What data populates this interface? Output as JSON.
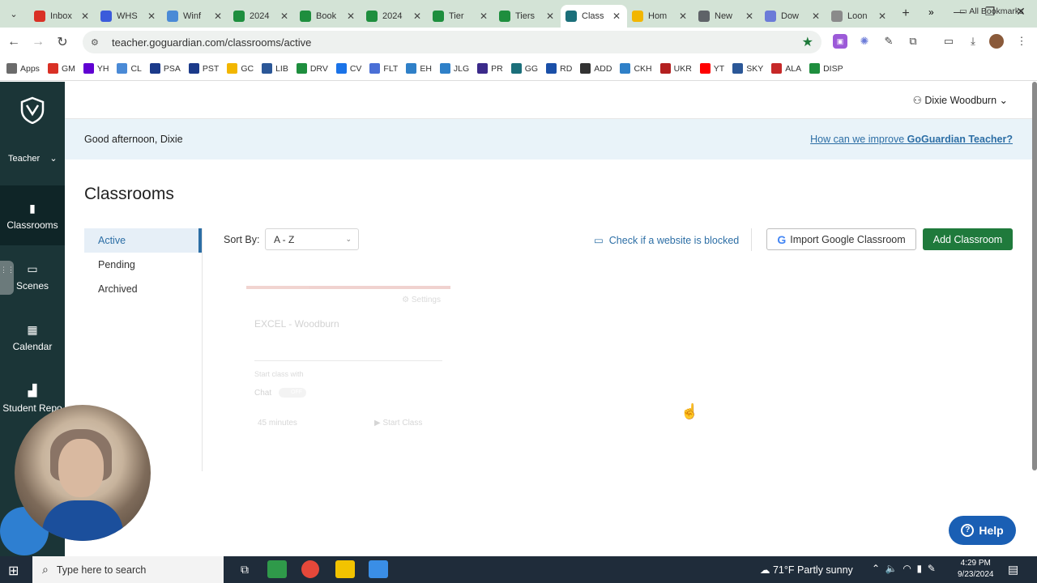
{
  "browser": {
    "tabs": [
      {
        "title": "Inbox",
        "color": "#d93025",
        "icon": "gmail-icon"
      },
      {
        "title": "WHS",
        "color": "#3b5bdb",
        "icon": "forms-icon"
      },
      {
        "title": "Winf",
        "color": "#4a8ad6",
        "icon": "calendar-icon"
      },
      {
        "title": "2024",
        "color": "#1e8e3e",
        "icon": "sheets-icon"
      },
      {
        "title": "Book",
        "color": "#1e8e3e",
        "icon": "sheets-icon"
      },
      {
        "title": "2024",
        "color": "#1e8e3e",
        "icon": "sheets-icon"
      },
      {
        "title": "Tier",
        "color": "#1e8e3e",
        "icon": "sheets-icon"
      },
      {
        "title": "Tiers",
        "color": "#1e8e3e",
        "icon": "sheets-icon"
      },
      {
        "title": "Class",
        "color": "#1b6f7a",
        "icon": "goguardian-icon",
        "active": true
      },
      {
        "title": "Hom",
        "color": "#f2b600",
        "icon": "classroom-icon"
      },
      {
        "title": "New",
        "color": "#5f6368",
        "icon": "chrome-icon"
      },
      {
        "title": "Dow",
        "color": "#6b7bd8",
        "icon": "gear-icon"
      },
      {
        "title": "Loon",
        "color": "#8a8a8a",
        "icon": "web-icon"
      }
    ],
    "new_tab": "+",
    "url": "teacher.goguardian.com/classrooms/active",
    "bookmarks": [
      {
        "label": "Apps",
        "color": "#6b6b6b"
      },
      {
        "label": "GM",
        "color": "#d93025"
      },
      {
        "label": "YH",
        "color": "#6001d2"
      },
      {
        "label": "CL",
        "color": "#4a8ad6"
      },
      {
        "label": "PSA",
        "color": "#1b3a8a"
      },
      {
        "label": "PST",
        "color": "#1b3a8a"
      },
      {
        "label": "GC",
        "color": "#f2b600"
      },
      {
        "label": "LIB",
        "color": "#2b5797"
      },
      {
        "label": "DRV",
        "color": "#1e8e3e"
      },
      {
        "label": "CV",
        "color": "#1a73e8"
      },
      {
        "label": "FLT",
        "color": "#4a6fd6"
      },
      {
        "label": "EH",
        "color": "#2f80c8"
      },
      {
        "label": "JLG",
        "color": "#2f80c8"
      },
      {
        "label": "PR",
        "color": "#3b2a8a"
      },
      {
        "label": "GG",
        "color": "#1b6f7a"
      },
      {
        "label": "RD",
        "color": "#1a4fa8"
      },
      {
        "label": "ADD",
        "color": "#333333"
      },
      {
        "label": "CKH",
        "color": "#2f80c8"
      },
      {
        "label": "UKR",
        "color": "#b32020"
      },
      {
        "label": "YT",
        "color": "#ff0000"
      },
      {
        "label": "SKY",
        "color": "#2b5797"
      },
      {
        "label": "ALA",
        "color": "#c62828"
      },
      {
        "label": "DISP",
        "color": "#1e8e3e"
      }
    ],
    "bookmarks_more": "»",
    "all_bookmarks": "All Bookmarks"
  },
  "sidebar": {
    "role": "Teacher",
    "items": [
      {
        "label": "Classrooms",
        "icon": "book-icon",
        "active": true
      },
      {
        "label": "Scenes",
        "icon": "scenes-icon"
      },
      {
        "label": "Calendar",
        "icon": "calendar-icon"
      },
      {
        "label": "Student Repo",
        "icon": "bar-chart-icon"
      }
    ]
  },
  "header": {
    "user": "Dixie Woodburn",
    "greeting": "Good afternoon, Dixie",
    "improve_prefix": "How can we improve ",
    "improve_brand": "GoGuardian Teacher?"
  },
  "main": {
    "title": "Classrooms",
    "subnav": [
      "Active",
      "Pending",
      "Archived"
    ],
    "sort_label": "Sort By:",
    "sort_value": "A - Z",
    "check_link": "Check if a website is blocked",
    "import_button": "Import Google Classroom",
    "add_button": "Add Classroom",
    "card": {
      "settings": "Settings",
      "name": "EXCEL - Woodburn",
      "start_with": "Start class with",
      "chat": "Chat",
      "chat_toggle": "OFF",
      "duration": "45 minutes",
      "start": "Start Class"
    },
    "help": "Help"
  },
  "taskbar": {
    "search_placeholder": "Type here to search",
    "weather": "71°F  Partly sunny",
    "time": "4:29 PM",
    "date": "9/23/2024"
  }
}
